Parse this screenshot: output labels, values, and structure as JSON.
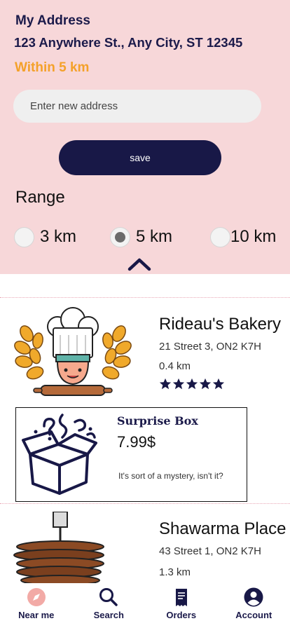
{
  "address": {
    "title": "My Address",
    "line": "123 Anywhere St., Any City, ST 12345",
    "range_text": "Within 5 km",
    "input_placeholder": "Enter new address",
    "input_value": "",
    "save_label": "save"
  },
  "range": {
    "title": "Range",
    "selected": "5 km",
    "options": [
      "3 km",
      "5 km",
      "10 km"
    ]
  },
  "listings": [
    {
      "name": "Rideau's Bakery",
      "address": "21 Street 3, ON2 K7H",
      "distance": "0.4 km",
      "rating": 5,
      "image_icon": "chef-icon",
      "offer": {
        "title": "Surprise Box",
        "price": "7.99$",
        "description": "It's sort of a mystery, isn't it?",
        "icon": "mystery-box-icon"
      }
    },
    {
      "name": "Shawarma Place",
      "address": "43 Street 1, ON2 K7H",
      "distance": "1.3 km",
      "image_icon": "shawarma-icon"
    }
  ],
  "nav": {
    "items": [
      {
        "label": "Near me",
        "icon": "compass-icon",
        "active": true
      },
      {
        "label": "Search",
        "icon": "search-icon"
      },
      {
        "label": "Orders",
        "icon": "receipt-icon"
      },
      {
        "label": "Account",
        "icon": "account-icon"
      }
    ]
  },
  "colors": {
    "panel_bg": "#f7d7d9",
    "navy": "#181847",
    "accent_orange": "#f4a12a",
    "nav_active_icon": "#f2aaa6"
  }
}
